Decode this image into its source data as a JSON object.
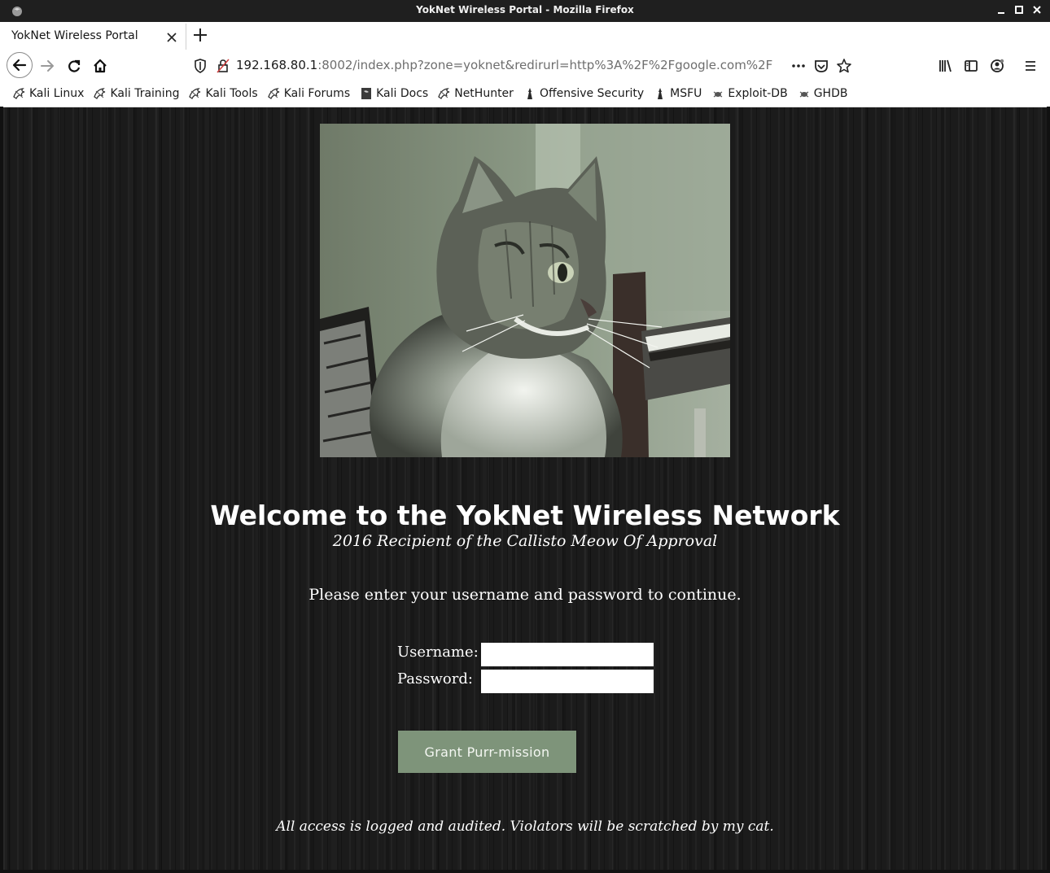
{
  "window": {
    "title": "YokNet Wireless Portal - Mozilla Firefox"
  },
  "tabs": [
    {
      "label": "YokNet Wireless Portal",
      "active": true
    }
  ],
  "navbar": {
    "url_host": "192.168.80.1",
    "url_rest": ":8002/index.php?zone=yoknet&redirurl=http%3A%2F%2Fgoogle.com%2F"
  },
  "bookmarks": [
    {
      "label": "Kali Linux",
      "icon": "kali-dragon-icon"
    },
    {
      "label": "Kali Training",
      "icon": "kali-dragon-icon"
    },
    {
      "label": "Kali Tools",
      "icon": "kali-dragon-icon"
    },
    {
      "label": "Kali Forums",
      "icon": "kali-dragon-icon"
    },
    {
      "label": "Kali Docs",
      "icon": "docs-icon"
    },
    {
      "label": "NetHunter",
      "icon": "kali-dragon-icon"
    },
    {
      "label": "Offensive Security",
      "icon": "offsec-icon"
    },
    {
      "label": "MSFU",
      "icon": "offsec-icon"
    },
    {
      "label": "Exploit-DB",
      "icon": "exploitdb-bug-icon"
    },
    {
      "label": "GHDB",
      "icon": "exploitdb-bug-icon"
    }
  ],
  "page": {
    "welcome": "Welcome to the YokNet Wireless Network",
    "subtitle": "2016 Recipient of the Callisto Meow Of Approval",
    "prompt": "Please enter your username and password to continue.",
    "username_label": "Username:",
    "password_label": "Password:",
    "username_value": "",
    "password_value": "",
    "submit_label": "Grant Purr-mission",
    "footer_note": "All access is logged and audited. Violators will be scratched by my cat."
  },
  "colors": {
    "page_background": "#1b1b1b",
    "button_background": "#7e947a",
    "text": "#ffffff"
  }
}
